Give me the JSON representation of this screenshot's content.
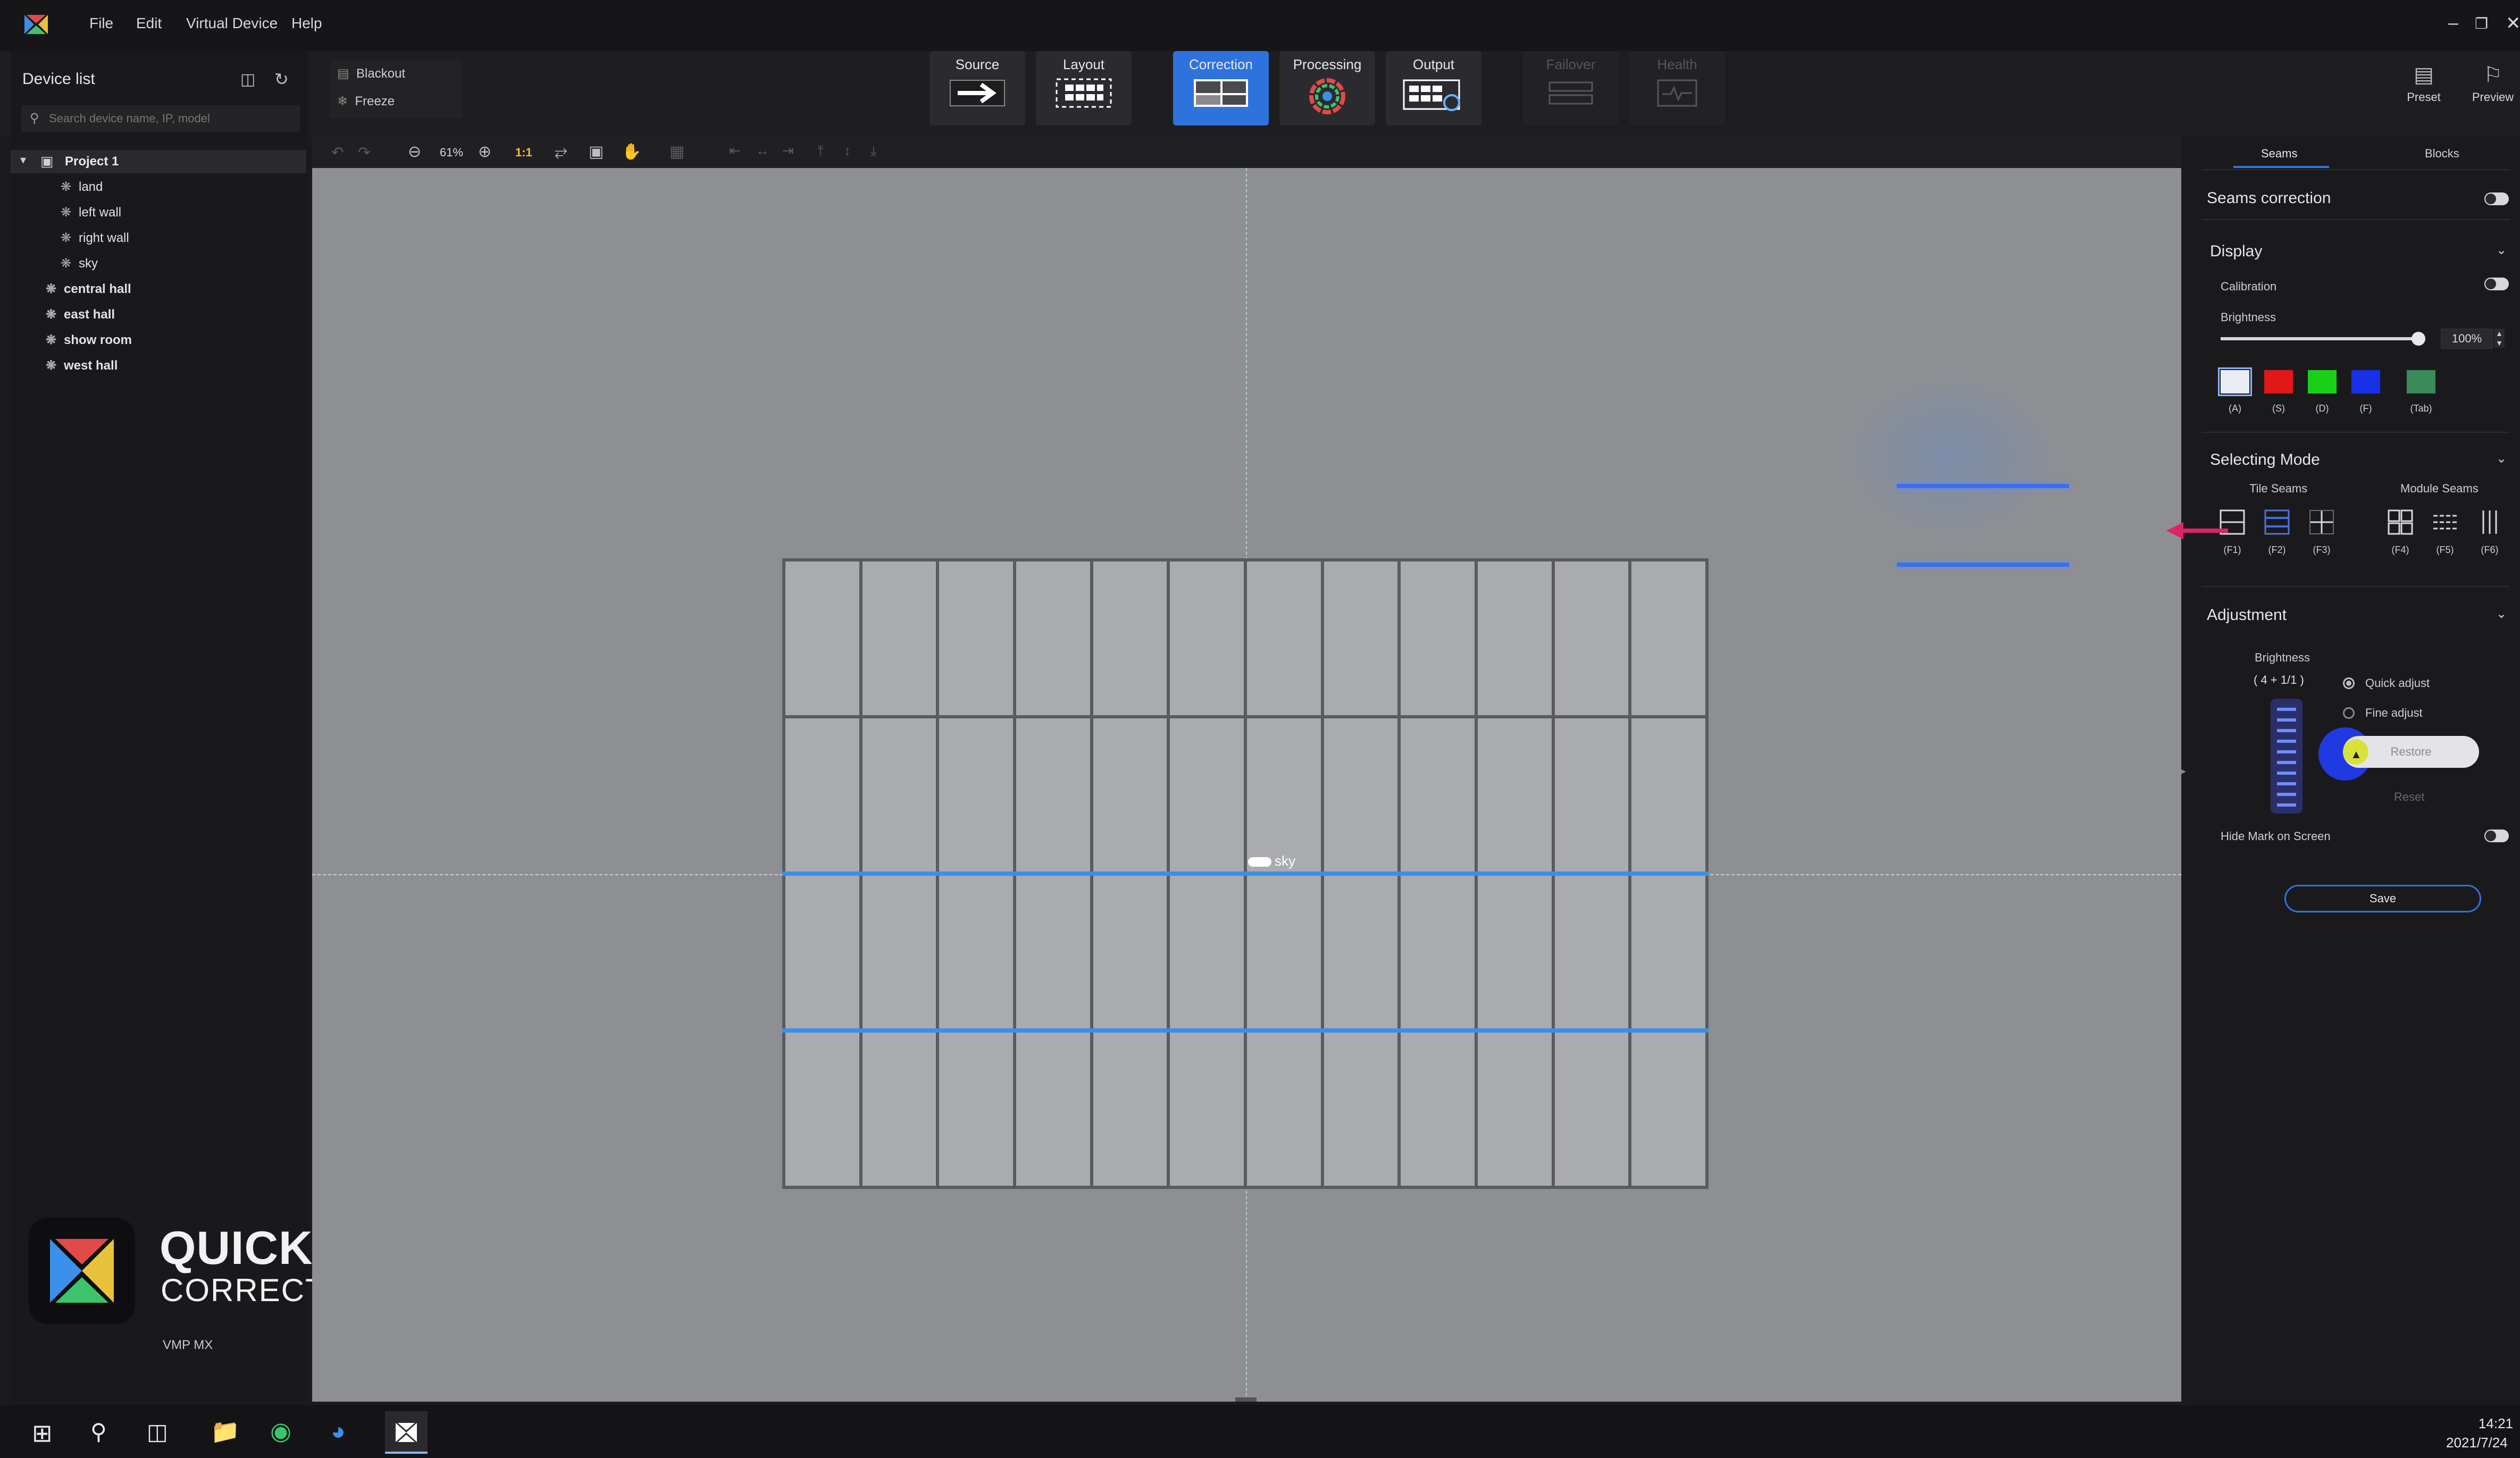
{
  "menu": {
    "items": [
      "File",
      "Edit",
      "Virtual Device",
      "Help"
    ]
  },
  "toolbar": {
    "blackout": "Blackout",
    "freeze": "Freeze",
    "buttons": [
      {
        "label": "Source"
      },
      {
        "label": "Layout"
      },
      {
        "label": "Correction"
      },
      {
        "label": "Processing"
      },
      {
        "label": "Output"
      },
      {
        "label": "Failover"
      },
      {
        "label": "Health"
      }
    ],
    "preset": "Preset",
    "preview": "Preview",
    "zoom": "61%",
    "ratio": "1:1"
  },
  "sidebar": {
    "title": "Device list",
    "search_placeholder": "Search device name, IP, model",
    "project": "Project 1",
    "project_children": [
      "land",
      "left wall",
      "right wall",
      "sky"
    ],
    "items": [
      "central hall",
      "east hall",
      "show room",
      "west hall"
    ]
  },
  "canvas": {
    "screen_label": "sky",
    "rows": 4,
    "cols": 12,
    "accent": "#3b8fe8",
    "annotation_arrow": "#e0226a"
  },
  "right_panel": {
    "tabs": [
      "Seams",
      "Blocks"
    ],
    "seams_correction": "Seams correction",
    "display": {
      "title": "Display",
      "calibration": "Calibration",
      "brightness": "Brightness",
      "brightness_value": "100%",
      "brightness_level": 1.0,
      "swatches": [
        {
          "key": "(A)",
          "color": "#e8ecf4"
        },
        {
          "key": "(S)",
          "color": "#e01818"
        },
        {
          "key": "(D)",
          "color": "#18d018"
        },
        {
          "key": "(F)",
          "color": "#1830e8"
        },
        {
          "key": "(Tab)",
          "color": "#3a8a5a"
        }
      ]
    },
    "selecting_mode": {
      "title": "Selecting Mode",
      "tile_seams": "Tile Seams",
      "module_seams": "Module Seams",
      "keys": [
        "(F1)",
        "(F2)",
        "(F3)",
        "(F4)",
        "(F5)",
        "(F6)"
      ]
    },
    "adjustment": {
      "title": "Adjustment",
      "brightness": "Brightness",
      "value": "( 4 + 1/1 )",
      "quick_adjust": "Quick adjust",
      "fine_adjust": "Fine adjust",
      "restore": "Restore",
      "reset": "Reset"
    },
    "hide_mark": "Hide Mark on Screen",
    "save": "Save"
  },
  "overlay": {
    "title_line1": "QUICK SCREEN",
    "title_line2": "CORRECTION",
    "brand": "VMP MX"
  },
  "taskbar": {
    "time": "14:21",
    "date": "2021/7/24"
  },
  "colors": {
    "accent": "#2e73dd",
    "seam": "#3b8fe8"
  }
}
